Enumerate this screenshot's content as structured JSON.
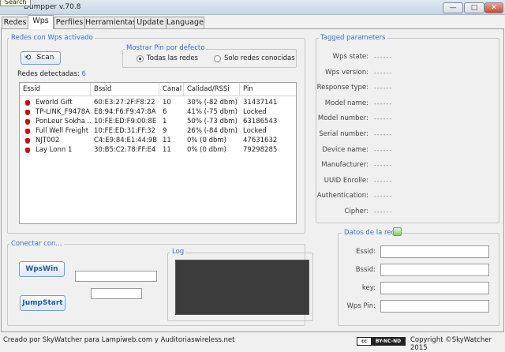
{
  "window": {
    "title": "Dumpper v.70.8",
    "tooltip": "Search",
    "minimize_glyph": "—",
    "maximize_glyph": "□",
    "close_glyph": "✕"
  },
  "tabs": [
    {
      "label": "Redes"
    },
    {
      "label": "Wps"
    },
    {
      "label": "Perfiles"
    },
    {
      "label": "Herramientas"
    },
    {
      "label": "Update"
    },
    {
      "label": "Language"
    }
  ],
  "wps_group": {
    "legend": "Redes con Wps activado",
    "scan_button": "Scan",
    "pin_group_legend": "Mostrar Pin por defecto",
    "radio_all": "Todas las redes",
    "radio_known": "Solo redes conocidas",
    "detected_label": "Redes detectadas:",
    "detected_count": "6"
  },
  "table": {
    "columns": [
      "Essid",
      "Bssid",
      "Canal",
      "Calidad/RSSi",
      "Pin"
    ],
    "rows": [
      [
        "Eworld Gift",
        "60:E3:27:2F:F8:22",
        "10",
        "30% (-82 dbm)",
        "31437141"
      ],
      [
        "TP-LINK_F9478A",
        "E8:94:F6:F9:47:8A",
        "6",
        "41% (-75 dbm)",
        "Locked"
      ],
      [
        "PonLeur Sokha ...",
        "10:FE:ED:F9:00:8E",
        "1",
        "50% (-73 dbm)",
        "63186543"
      ],
      [
        "Full Well Freight",
        "10:FE:ED:31:FF:32",
        "9",
        "26% (-84 dbm)",
        "Locked"
      ],
      [
        "NJT002",
        "C4:E9:84:E1:44:9B",
        "11",
        "0% (0 dbm)",
        "47631632"
      ],
      [
        "Lay Lonn 1",
        "30:B5:C2:78:FF:E4",
        "11",
        "0% (0 dbm)",
        "79298285"
      ]
    ]
  },
  "tagged": {
    "legend": "Tagged parameters",
    "dashes": "------",
    "params": [
      "Wps state:",
      "Wps version:",
      "Response type:",
      "Model name:",
      "Model number:",
      "Serial number:",
      "Device name:",
      "Manufacturer:",
      "UUID Enrolle:",
      "Authentication:",
      "Cipher:"
    ]
  },
  "connect": {
    "legend": "Conectar con...",
    "wpswin_button": "WpsWin",
    "jumpstart_button": "JumpStart",
    "log_legend": "Log"
  },
  "datos": {
    "legend": "Datos de la red",
    "fields": [
      "Essid:",
      "Bssid:",
      "key:",
      "Wps Pin:"
    ]
  },
  "status": {
    "left_text": "Creado por SkyWatcher para Lampiweb.com y Auditoriaswireless.net",
    "license_cc": "cc",
    "license_badge": "BY-NC-ND",
    "copyright": "Copyright ©SkyWatcher 2015"
  },
  "colors": {
    "accent": "#3a6fcf",
    "signal_icon": "#cc1010",
    "log_bg": "#3c3c3c"
  }
}
